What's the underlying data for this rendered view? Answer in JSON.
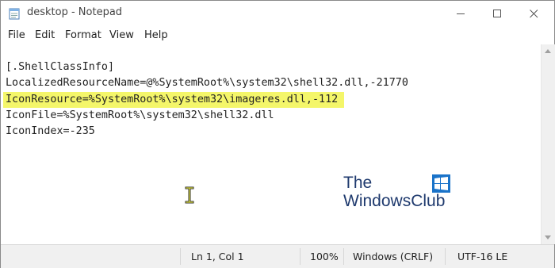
{
  "window": {
    "title": "desktop - Notepad"
  },
  "menu": {
    "items": [
      "File",
      "Edit",
      "Format",
      "View",
      "Help"
    ]
  },
  "editor": {
    "lines": [
      "[.ShellClassInfo]",
      "LocalizedResourceName=@%SystemRoot%\\system32\\shell32.dll,-21770",
      "IconResource=%SystemRoot%\\system32\\imageres.dll,-112",
      "IconFile=%SystemRoot%\\system32\\shell32.dll",
      "IconIndex=-235"
    ],
    "highlighted_line_index": 2,
    "highlight_color": "#f4f66a"
  },
  "watermark": {
    "line1": "The",
    "line2": "WindowsClub",
    "color": "#1f3a6e"
  },
  "status": {
    "position": "Ln 1, Col 1",
    "zoom": "100%",
    "line_ending": "Windows (CRLF)",
    "encoding": "UTF-16 LE"
  },
  "icons": {
    "app": "notepad-icon",
    "minimize": "minimize-icon",
    "maximize": "maximize-icon",
    "close": "close-icon",
    "cursor": "text-cursor-icon",
    "logo": "windows-logo-icon"
  }
}
